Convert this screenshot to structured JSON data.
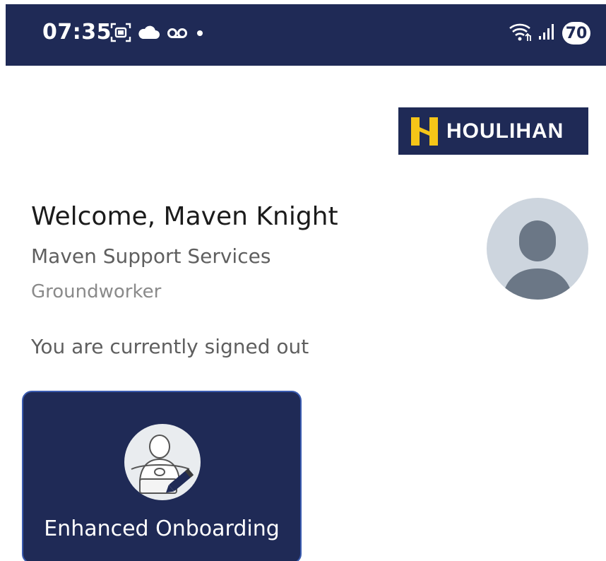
{
  "status_bar": {
    "time": "07:35",
    "left_icons": [
      "screenshot-icon",
      "cloud-icon",
      "voicemail-icon",
      "dot-icon"
    ],
    "right_icons": [
      "wifi-icon",
      "signal-icon"
    ],
    "battery": "70",
    "background": "#1f2a56"
  },
  "brand": {
    "name": "HOULIHAN",
    "mark_color": "#f5c518",
    "background": "#1f2a56"
  },
  "profile": {
    "welcome": "Welcome, Maven Knight",
    "company": "Maven Support Services",
    "role": "Groundworker",
    "status": "You are currently signed out",
    "avatar_icon": "user-avatar-icon"
  },
  "tiles": [
    {
      "label": "Enhanced Onboarding",
      "icon": "driver-onboarding-icon",
      "background": "#1f2a56"
    }
  ]
}
